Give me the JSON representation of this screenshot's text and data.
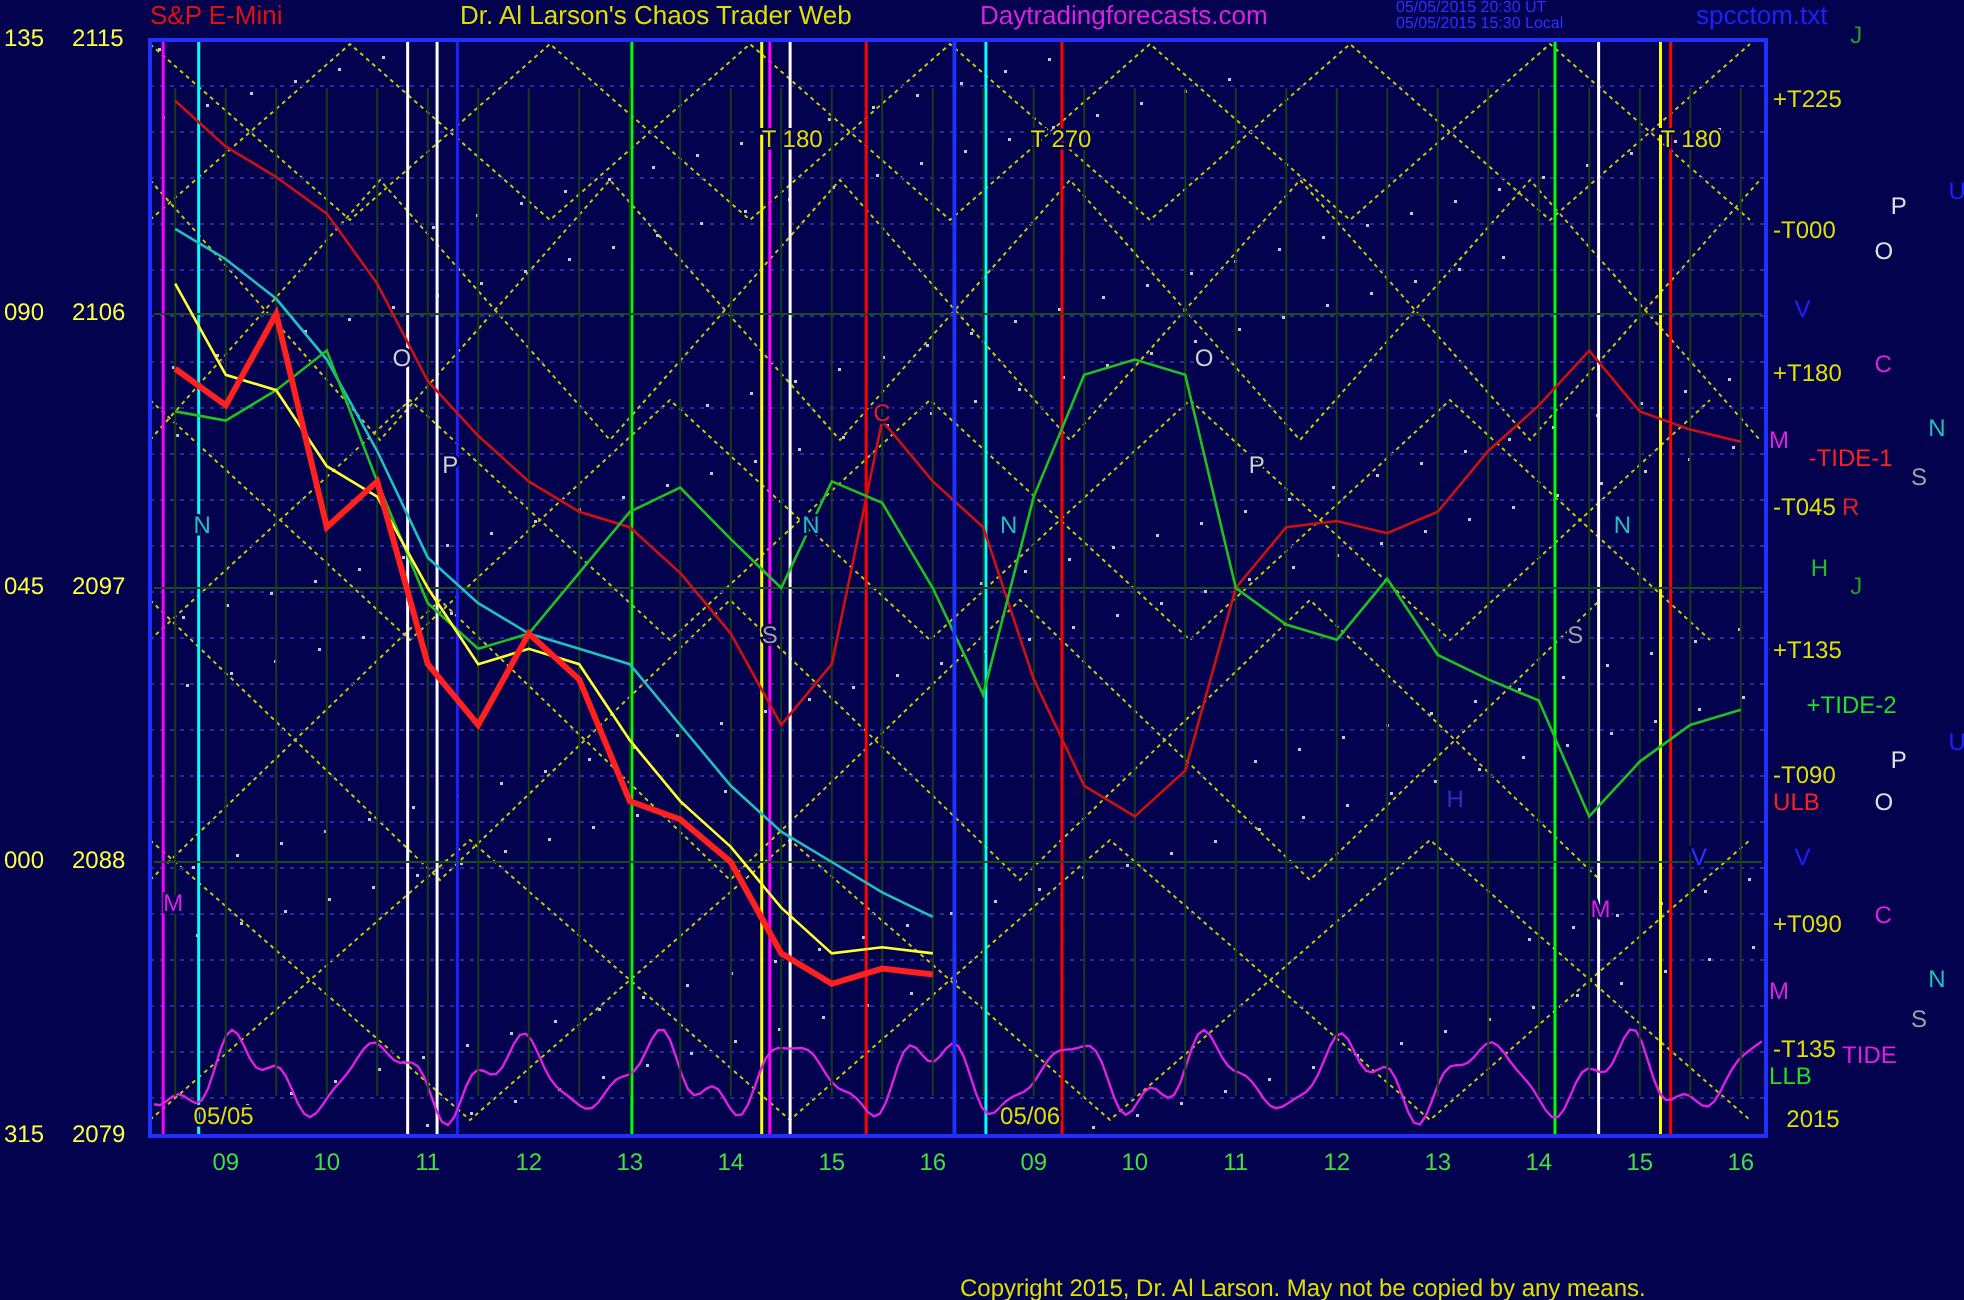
{
  "header": {
    "symbol": "S&P E-Mini",
    "title": "Dr. Al Larson's Chaos Trader Web",
    "website": "Daytradingforecasts.com",
    "timestamps": [
      "05/05/2015 20:30 UT",
      "05/05/2015 15:30 Local"
    ],
    "filename": "spcctom.txt"
  },
  "chart": {
    "angle_labels": [
      "135",
      "090",
      "045",
      "000",
      "315"
    ],
    "chart_data": {
      "type": "line",
      "categories": [
        null,
        "09",
        null,
        "10",
        null,
        "11",
        null,
        "12",
        null,
        "13",
        null,
        "14",
        null,
        "15",
        null,
        "16",
        null,
        "09",
        null,
        "10",
        null,
        "11",
        null,
        "12",
        null,
        "13",
        null,
        "14",
        null,
        "15",
        null,
        "16"
      ],
      "series": [
        {
          "color": "#d01010",
          "values": [
            2113,
            2111.5,
            2110.5,
            2109.3,
            2107,
            2103.8,
            2102,
            2100.5,
            2099.5,
            2099,
            2097.5,
            2095.5,
            2092.5,
            2094.5,
            2102.5,
            2100.5,
            2099,
            2094,
            2090.5,
            2089.5,
            2091,
            2097,
            2099,
            2099.2,
            2098.8,
            2099.5,
            2101.5,
            2103,
            2104.8,
            2102.8,
            2102.2,
            2101.8
          ]
        },
        {
          "color": "#20c0c0",
          "values": [
            2108.8,
            2107.8,
            2106.5,
            2104.5,
            2101.5,
            2098,
            2096.5,
            2095.5,
            2095,
            2094.5,
            2092.5,
            2090.5,
            2089,
            2088,
            2087,
            2086.2,
            null,
            null,
            null,
            null,
            null,
            null,
            null,
            null,
            null,
            null,
            null,
            null,
            null,
            null,
            null,
            null
          ]
        },
        {
          "color": "#20c020",
          "values": [
            2102.8,
            2102.5,
            2103.5,
            2104.8,
            2100.5,
            2096.5,
            2095,
            2095.5,
            2097.5,
            2099.5,
            2100.3,
            2098.6,
            2097,
            2100.5,
            2099.8,
            2097,
            2093.5,
            2100,
            2104,
            2104.5,
            2104,
            2097,
            2095.8,
            2095.3,
            2097.3,
            2094.8,
            2094,
            2093.3,
            2089.5,
            2091.3,
            2092.5,
            2093
          ]
        },
        {
          "color": "#ffff30",
          "values": [
            2107,
            2104,
            2103.5,
            2101,
            2100,
            2097,
            2094.5,
            2095,
            2094.5,
            2092,
            2090,
            2088.5,
            2086.5,
            2085,
            2085.2,
            2085,
            null,
            null,
            null,
            null,
            null,
            null,
            null,
            null,
            null,
            null,
            null,
            null,
            null,
            null,
            null,
            null
          ]
        },
        {
          "color": "#ff2020",
          "values": [
            2104.2,
            2103,
            2106,
            2099,
            2100.5,
            2094.5,
            2092.5,
            2095.5,
            2094,
            2090,
            2089.4,
            2088,
            2085,
            2084,
            2084.5,
            2084.3,
            null,
            null,
            null,
            null,
            null,
            null,
            null,
            null,
            null,
            null,
            null,
            null,
            null,
            null,
            null,
            null
          ]
        }
      ],
      "ylim": [
        2079,
        2115
      ],
      "grid": true,
      "yticks": [
        2115,
        2106,
        2097,
        2088,
        2079
      ]
    },
    "labels": [
      {
        "text": "T 180",
        "color": "#e0e000"
      },
      {
        "text": "T 270",
        "color": "#e0e000"
      },
      {
        "text": "T 180",
        "color": "#e0e000"
      },
      {
        "text": "O",
        "color": "#d0d0d0"
      },
      {
        "text": "P",
        "color": "#d0d0d0"
      },
      {
        "text": "C",
        "color": "#e02020"
      },
      {
        "text": "N",
        "color": "#20c0c0"
      },
      {
        "text": "N",
        "color": "#20c0c0"
      },
      {
        "text": "S",
        "color": "#a0a0a0"
      },
      {
        "text": "M",
        "color": "#e020e0"
      },
      {
        "text": "O",
        "color": "#d0d0d0"
      },
      {
        "text": "P",
        "color": "#d0d0d0"
      },
      {
        "text": "N",
        "color": "#20c0c0"
      },
      {
        "text": "N",
        "color": "#20c0c0"
      },
      {
        "text": "S",
        "color": "#a0a0a0"
      },
      {
        "text": "H",
        "color": "#3030c0"
      },
      {
        "text": "V",
        "color": "#3030ff"
      },
      {
        "text": "M",
        "color": "#e020e0"
      },
      {
        "text": "05/05",
        "color": "#e0e000"
      },
      {
        "text": "05/06",
        "color": "#e0e000"
      },
      {
        "text": "J",
        "color": "#20a020"
      },
      {
        "text": "+T225",
        "color": "#e0e000"
      },
      {
        "text": "U",
        "color": "#2020ff"
      },
      {
        "text": "P",
        "color": "#e0e0e0"
      },
      {
        "text": "-T000",
        "color": "#e0e000"
      },
      {
        "text": "O",
        "color": "#e0e0e0"
      },
      {
        "text": "V",
        "color": "#2020ff"
      },
      {
        "text": "+T180",
        "color": "#e0e000"
      },
      {
        "text": "C",
        "color": "#e020e0"
      },
      {
        "text": "N",
        "color": "#20c0c0"
      },
      {
        "text": "M",
        "color": "#e020e0"
      },
      {
        "text": "-TIDE-1",
        "color": "#ff2020"
      },
      {
        "text": "S",
        "color": "#a0a0a0"
      },
      {
        "text": "-T045",
        "color": "#e0e000"
      },
      {
        "text": "R",
        "color": "#e02020"
      },
      {
        "text": "H",
        "color": "#20c020"
      },
      {
        "text": "J",
        "color": "#20a020"
      },
      {
        "text": "+T135",
        "color": "#e0e000"
      },
      {
        "text": "+TIDE-2",
        "color": "#20e020"
      },
      {
        "text": "U",
        "color": "#2020ff"
      },
      {
        "text": "P",
        "color": "#e0e0e0"
      },
      {
        "text": "-T090",
        "color": "#e0e000"
      },
      {
        "text": "ULB",
        "color": "#ff2020"
      },
      {
        "text": "O",
        "color": "#e0e0e0"
      },
      {
        "text": "V",
        "color": "#2020ff"
      },
      {
        "text": "+T090",
        "color": "#e0e000"
      },
      {
        "text": "C",
        "color": "#e020e0"
      },
      {
        "text": "N",
        "color": "#20c0c0"
      },
      {
        "text": "M",
        "color": "#e020e0"
      },
      {
        "text": "S",
        "color": "#a0a0a0"
      },
      {
        "text": "-T135",
        "color": "#e0e000"
      },
      {
        "text": "TIDE",
        "color": "#e020e0"
      },
      {
        "text": "LLB",
        "color": "#20e020"
      },
      {
        "text": "2015",
        "color": "#e0e000"
      }
    ]
  },
  "copyright": "Copyright 2015, Dr. Al Larson. May not be copied by any means."
}
